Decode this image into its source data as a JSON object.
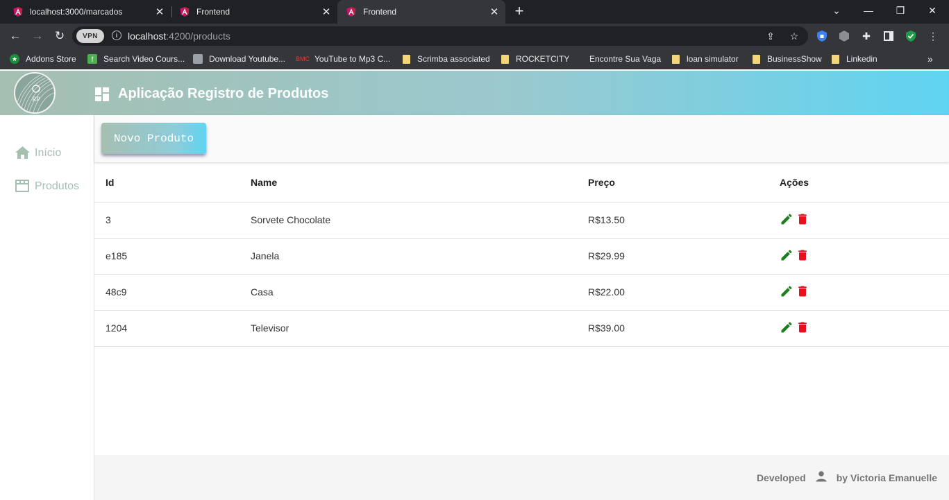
{
  "browser": {
    "tabs": [
      {
        "title": "localhost:3000/marcados"
      },
      {
        "title": "Frontend"
      },
      {
        "title": "Frontend"
      }
    ],
    "url": {
      "host": "localhost",
      "rest": ":4200/products"
    },
    "vpn_label": "VPN",
    "bookmarks": [
      {
        "label": "Addons Store"
      },
      {
        "label": "Search Video Cours..."
      },
      {
        "label": "Download Youtube..."
      },
      {
        "label": "YouTube to Mp3 C..."
      },
      {
        "label": "Scrimba associated"
      },
      {
        "label": "ROCKETCITY"
      },
      {
        "label": "Encontre Sua Vaga"
      },
      {
        "label": "loan simulator"
      },
      {
        "label": "BusinessShow"
      },
      {
        "label": "Linkedin"
      }
    ]
  },
  "header": {
    "title": "Aplicação Registro de Produtos"
  },
  "sidebar": {
    "items": [
      {
        "label": "Início",
        "icon": "home-icon"
      },
      {
        "label": "Produtos",
        "icon": "storefront-icon"
      }
    ]
  },
  "toolbar": {
    "new_product_label": "Novo Produto"
  },
  "table": {
    "columns": [
      "Id",
      "Name",
      "Preço",
      "Ações"
    ],
    "rows": [
      {
        "id": "3",
        "name": "Sorvete Chocolate",
        "price": "R$13.50"
      },
      {
        "id": "e185",
        "name": "Janela",
        "price": "R$29.99"
      },
      {
        "id": "48c9",
        "name": "Casa",
        "price": "R$22.00"
      },
      {
        "id": "1204",
        "name": "Televisor",
        "price": "R$39.00"
      }
    ]
  },
  "footer": {
    "developed": "Developed",
    "by": "by Victoria Emanuelle"
  },
  "colors": {
    "accent_start": "#a5bfb1",
    "accent_end": "#5fd4f2",
    "edit": "#1e7d1e",
    "delete": "#e8101f"
  }
}
